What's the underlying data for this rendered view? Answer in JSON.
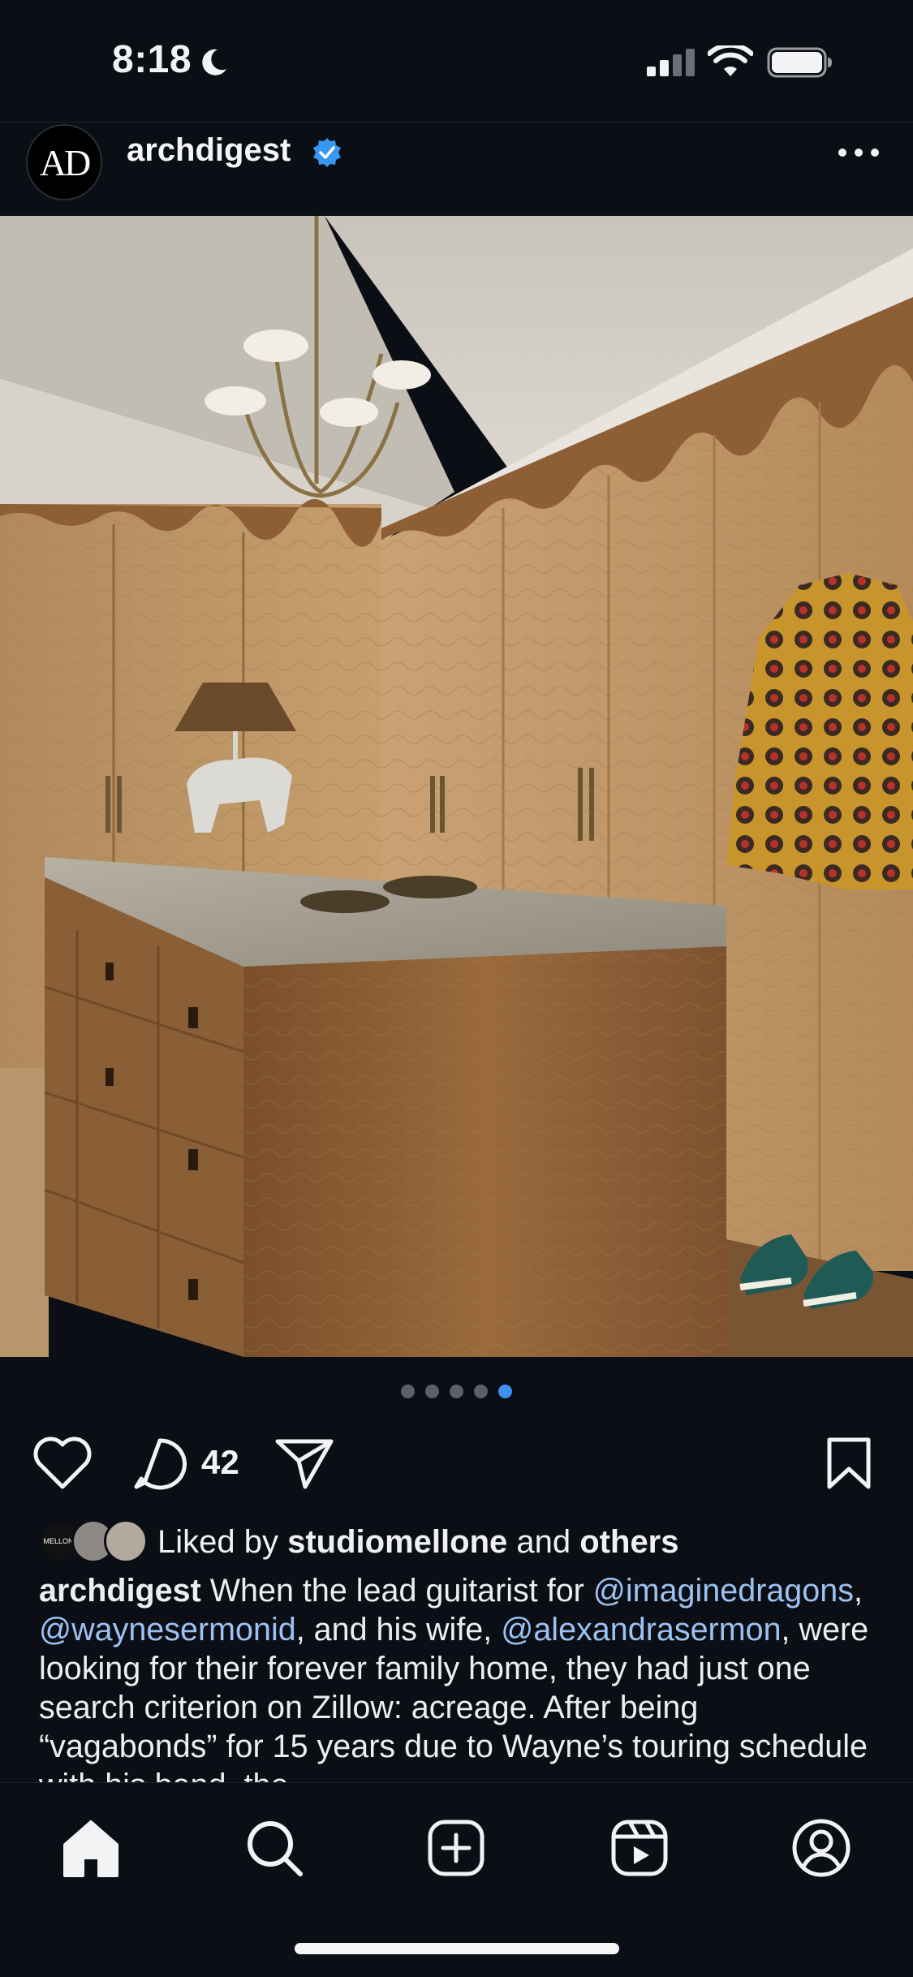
{
  "status_bar": {
    "time": "8:18",
    "icons": [
      "moon-icon",
      "cellular-signal-icon",
      "wifi-icon",
      "battery-icon"
    ]
  },
  "post": {
    "avatar_text": "AD",
    "username": "archdigest",
    "verified": true,
    "more_icon": "more-horizontal-icon",
    "image_alt": "Walk-in closet with oak cabinetry, marble-topped island, brass chandelier, ceramic horse lamp, patterned jacket and green sneakers",
    "carousel": {
      "count": 5,
      "active_index": 4
    },
    "comment_count": "42",
    "liked_by": {
      "prefix": "Liked by",
      "user": "studiomellone",
      "joiner": "and",
      "others": "others",
      "avatar_text": "MELLONE"
    },
    "caption": {
      "user": "archdigest",
      "t1": " When the lead guitarist for ",
      "m1": "@imaginedragons",
      "t2": ", ",
      "m2": "@waynesermonid",
      "t3": ", and his wife, ",
      "m3": "@alexandrasermon",
      "t4": ", were looking for their forever family home, they had just one search criterion on Zillow: acreage. After being “vagabonds” for 15 years due to Wayne’s touring schedule with his band, the"
    }
  },
  "colors": {
    "background": "#0b0e14",
    "mention": "#9bc2f2",
    "accent": "#3d8ff2",
    "verified": "#3897f0"
  },
  "tab_bar": {
    "tabs": [
      "home-icon",
      "search-icon",
      "create-icon",
      "reels-icon",
      "profile-icon"
    ],
    "active": "home-icon"
  }
}
